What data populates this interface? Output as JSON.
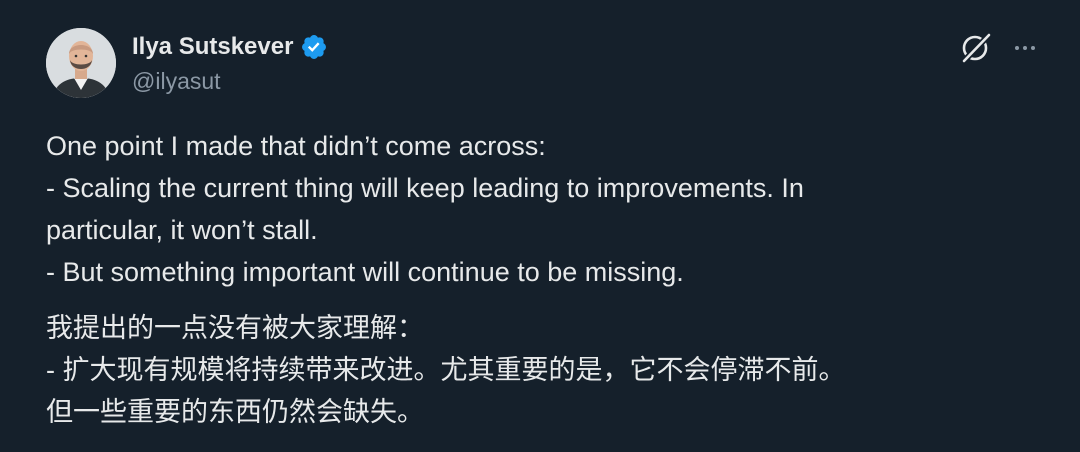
{
  "author": {
    "display_name": "Ilya Sutskever",
    "handle": "@ilyasut",
    "verified": true
  },
  "icons": {
    "avatar": "profile-photo",
    "verified": "verified-badge-icon",
    "grok": "grok-icon",
    "more": "more-options-icon"
  },
  "colors": {
    "background": "#15202b",
    "text": "#e7e9ea",
    "muted": "#8b98a5",
    "verified_blue": "#1d9bf0"
  },
  "tweet": {
    "en_lines": [
      "One point I made that didn’t come across:",
      "- Scaling the current thing will keep leading to improvements.  In",
      "particular, it won’t stall.",
      "- But something important will continue to be missing."
    ],
    "zh_lines": [
      "我提出的一点没有被大家理解：",
      "- 扩大现有规模将持续带来改进。尤其重要的是，它不会停滞不前。",
      "但一些重要的东西仍然会缺失。"
    ]
  }
}
